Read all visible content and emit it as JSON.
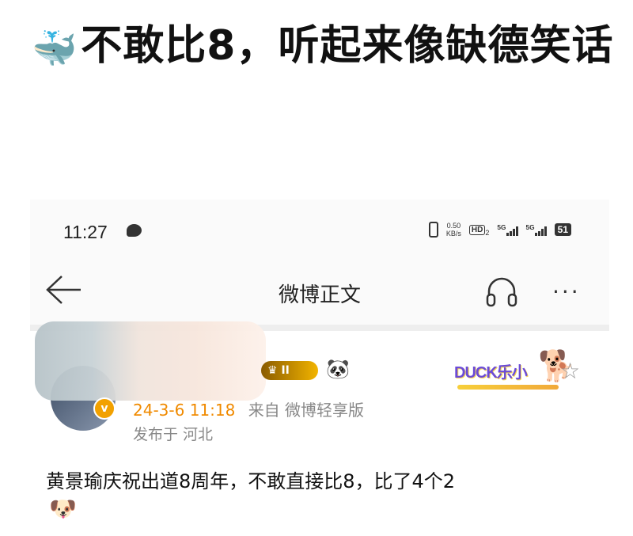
{
  "headline": {
    "emoji": "🐳",
    "text": "不敢比8，听起来像缺德笑话"
  },
  "status_bar": {
    "time": "11:27",
    "speed_value": "0.50",
    "speed_unit": "KB/s",
    "hd_label": "HD",
    "hd_sub": "2",
    "signal1": "5G",
    "signal2": "5G",
    "battery": "51"
  },
  "nav": {
    "title": "微博正文",
    "more": "···"
  },
  "post": {
    "badge_label": "II",
    "sticker_text": "DUCK乐小",
    "timestamp": "24-3-6 11:18",
    "source": "来自 微博轻享版",
    "location": "发布于 河北",
    "body": "黄景瑜庆祝出道8周年，不敢直接比8，比了4个2",
    "verified_mark": "v"
  },
  "icons": {
    "message": "message-bubble-icon",
    "back": "back-arrow-icon",
    "headphone": "headphone-icon",
    "more": "more-dots-icon",
    "star": "star-icon",
    "panda": "panda-icon",
    "doge": "doge-emoji-icon"
  },
  "colors": {
    "timestamp": "#f08a00",
    "meta": "#888888",
    "badge": "#f2b400"
  }
}
